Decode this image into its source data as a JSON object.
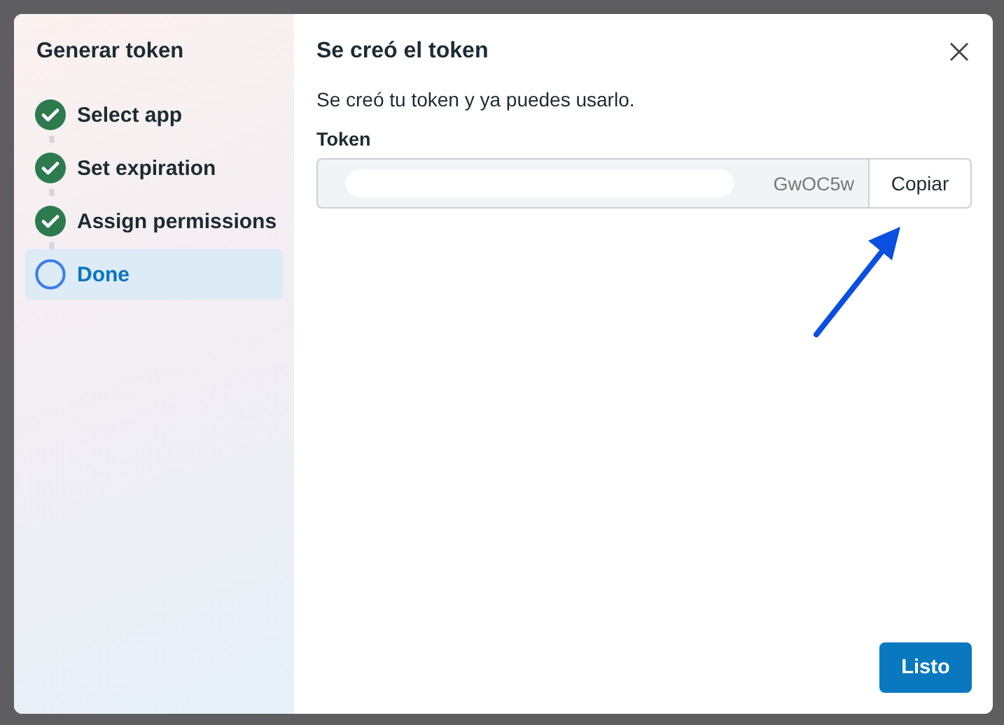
{
  "sidebar": {
    "title": "Generar token",
    "steps": [
      {
        "label": "Select app",
        "completed": true,
        "selected": false
      },
      {
        "label": "Set expiration",
        "completed": true,
        "selected": false
      },
      {
        "label": "Assign permissions",
        "completed": true,
        "selected": false
      },
      {
        "label": "Done",
        "completed": false,
        "selected": true
      }
    ]
  },
  "main": {
    "title": "Se creó el token",
    "message": "Se creó tu token y ya puedes usarlo.",
    "token": {
      "label": "Token",
      "value": "GwOC5w",
      "redacted": true
    },
    "copy_button": "Copiar",
    "done_button": "Listo"
  },
  "annotation": {
    "kind": "arrow"
  }
}
